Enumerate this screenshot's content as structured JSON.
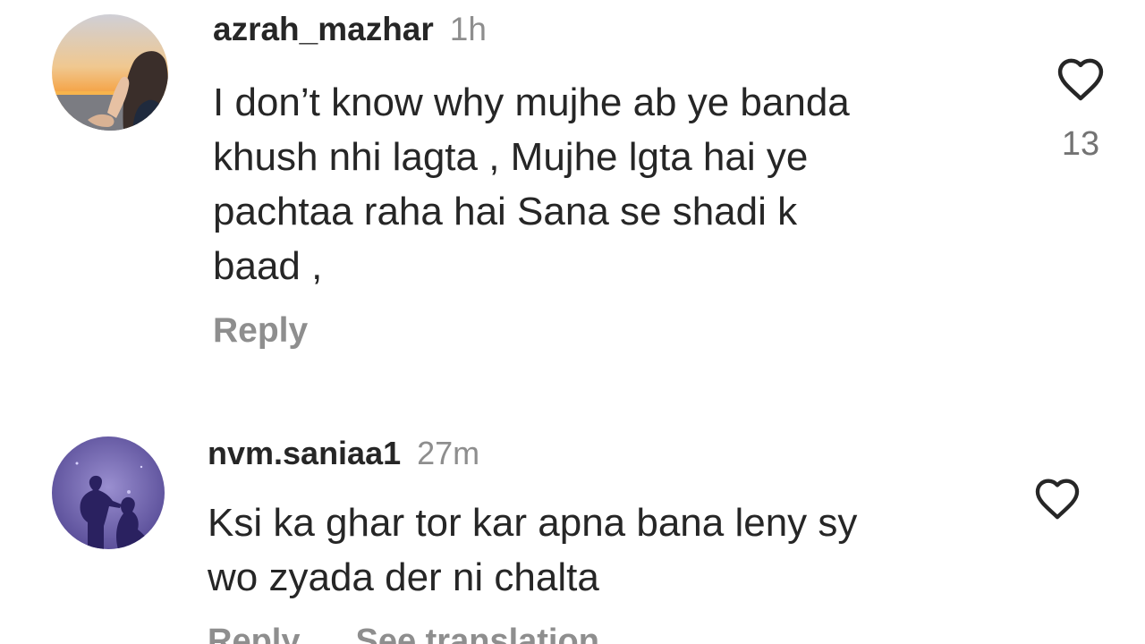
{
  "comments": [
    {
      "username": "azrah_mazhar",
      "time": "1h",
      "text_lines": [
        "I don’t know why mujhe ab ye banda",
        "khush nhi lagta , Mujhe lgta hai ye",
        "pachtaa raha hai Sana se shadi k",
        "baad ,"
      ],
      "reply_label": "Reply",
      "like_icon": "heart-outline-icon",
      "like_count": "13"
    },
    {
      "username": "nvm.saniaa1",
      "time": "27m",
      "text_lines": [
        "Ksi ka ghar tor kar apna bana leny sy",
        "wo zyada der ni chalta"
      ],
      "reply_label": "Reply",
      "translation_label": "See translation",
      "like_icon": "heart-outline-icon"
    }
  ],
  "colors": {
    "text_primary": "#262626",
    "text_secondary": "#8e8e8e",
    "background": "#ffffff"
  }
}
